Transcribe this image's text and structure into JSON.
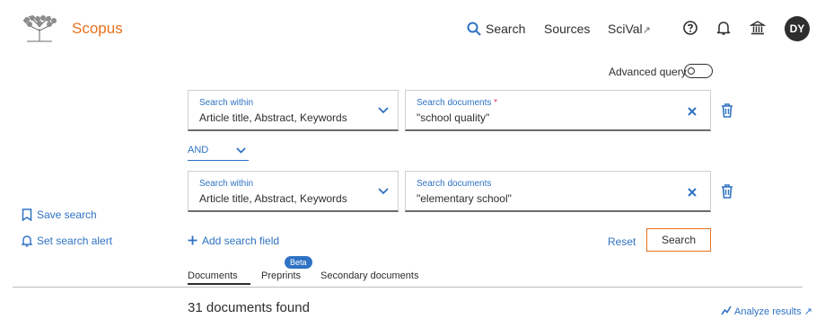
{
  "header": {
    "brand": "Scopus",
    "nav": {
      "search": "Search",
      "sources": "Sources",
      "scival": "SciVal",
      "scival_ext": "↗"
    },
    "avatar_initials": "DY",
    "icons": [
      "elsevier-logo",
      "search-icon",
      "help-icon",
      "bell-icon",
      "institution-icon"
    ]
  },
  "advanced_query": {
    "label": "Advanced query",
    "enabled": false
  },
  "search_rows": [
    {
      "within_label": "Search within",
      "within_value": "Article title, Abstract, Keywords",
      "docs_label": "Search documents",
      "docs_required_mark": "*",
      "docs_value": "\"school quality\""
    },
    {
      "within_label": "Search within",
      "within_value": "Article title, Abstract, Keywords",
      "docs_label": "Search documents",
      "docs_required_mark": "",
      "docs_value": "\"elementary school\""
    }
  ],
  "operator": "AND",
  "sidebar": {
    "save_search": "Save search",
    "set_alert": "Set search alert"
  },
  "actions": {
    "add_field": "Add search field",
    "reset": "Reset",
    "search": "Search"
  },
  "tabs": {
    "documents": "Documents",
    "preprints": "Preprints",
    "preprints_badge": "Beta",
    "secondary": "Secondary documents"
  },
  "results": {
    "found": "31 documents found",
    "analyze": "Analyze results",
    "analyze_ext": "↗"
  },
  "colors": {
    "brand": "#e9711c",
    "link": "#2e72c3",
    "text": "#2e2e2e"
  }
}
